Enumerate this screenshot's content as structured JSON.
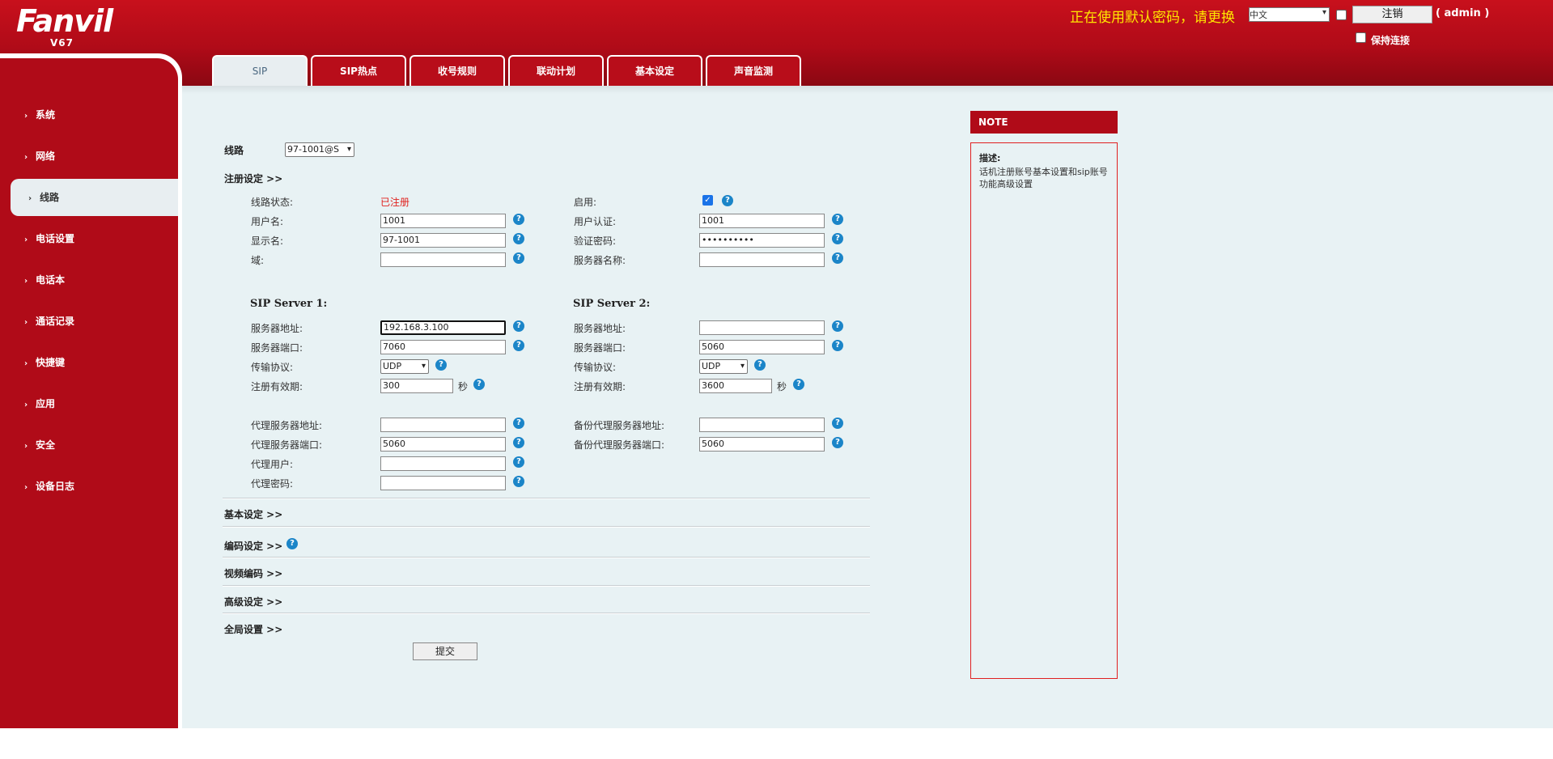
{
  "header": {
    "logo": "Fanvil",
    "model": "V67",
    "password_warning": "正在使用默认密码，请更换",
    "language": "中文",
    "logout_label": "注销",
    "user": "( admin )",
    "keep_connected_label": "保持连接"
  },
  "tabs": [
    {
      "label": "SIP"
    },
    {
      "label": "SIP热点"
    },
    {
      "label": "收号规则"
    },
    {
      "label": "联动计划"
    },
    {
      "label": "基本设定"
    },
    {
      "label": "声音监测"
    }
  ],
  "sidebar": {
    "items": [
      {
        "label": "系统"
      },
      {
        "label": "网络"
      },
      {
        "label": "线路"
      },
      {
        "label": "电话设置"
      },
      {
        "label": "电话本"
      },
      {
        "label": "通话记录"
      },
      {
        "label": "快捷键"
      },
      {
        "label": "应用"
      },
      {
        "label": "安全"
      },
      {
        "label": "设备日志"
      }
    ]
  },
  "form": {
    "line_label": "线路",
    "line_value": "97-1001@S",
    "registration_section": "注册设定 >>",
    "line_status_label": "线路状态:",
    "line_status_value": "已注册",
    "enable_label": "启用:",
    "username_label": "用户名:",
    "username_value": "1001",
    "auth_user_label": "用户认证:",
    "auth_user_value": "1001",
    "display_name_label": "显示名:",
    "display_name_value": "97-1001",
    "auth_password_label": "验证密码:",
    "auth_password_value": "••••••••••",
    "realm_label": "域:",
    "realm_value": "",
    "server_name_label": "服务器名称:",
    "server_name_value": "",
    "sip_server1_title": "SIP Server 1:",
    "sip_server2_title": "SIP Server 2:",
    "server1": {
      "address_label": "服务器地址:",
      "address_value": "192.168.3.100",
      "port_label": "服务器端口:",
      "port_value": "7060",
      "transport_label": "传输协议:",
      "transport_value": "UDP",
      "expires_label": "注册有效期:",
      "expires_value": "300",
      "unit": "秒"
    },
    "server2": {
      "address_label": "服务器地址:",
      "address_value": "",
      "port_label": "服务器端口:",
      "port_value": "5060",
      "transport_label": "传输协议:",
      "transport_value": "UDP",
      "expires_label": "注册有效期:",
      "expires_value": "3600",
      "unit": "秒"
    },
    "proxy": {
      "address_label": "代理服务器地址:",
      "address_value": "",
      "port_label": "代理服务器端口:",
      "port_value": "5060",
      "user_label": "代理用户:",
      "user_value": "",
      "password_label": "代理密码:",
      "password_value": "",
      "backup_address_label": "备份代理服务器地址:",
      "backup_address_value": "",
      "backup_port_label": "备份代理服务器端口:",
      "backup_port_value": "5060"
    },
    "sections": {
      "basic": "基本设定 >>",
      "codec": "编码设定 >>",
      "video": "视频编码 >>",
      "advanced": "高级设定 >>",
      "global": "全局设置 >>"
    },
    "submit_label": "提交"
  },
  "note": {
    "header": "NOTE",
    "title": "描述:",
    "text": "话机注册账号基本设置和sip账号功能高级设置"
  },
  "icons": {
    "help": "?",
    "checkmark": "✓",
    "chevron": "›"
  },
  "colors": {
    "brand_red": "#b00b18",
    "warning_yellow": "#ffe600",
    "status_red": "#e0201c",
    "help_blue": "#1b85c8"
  }
}
